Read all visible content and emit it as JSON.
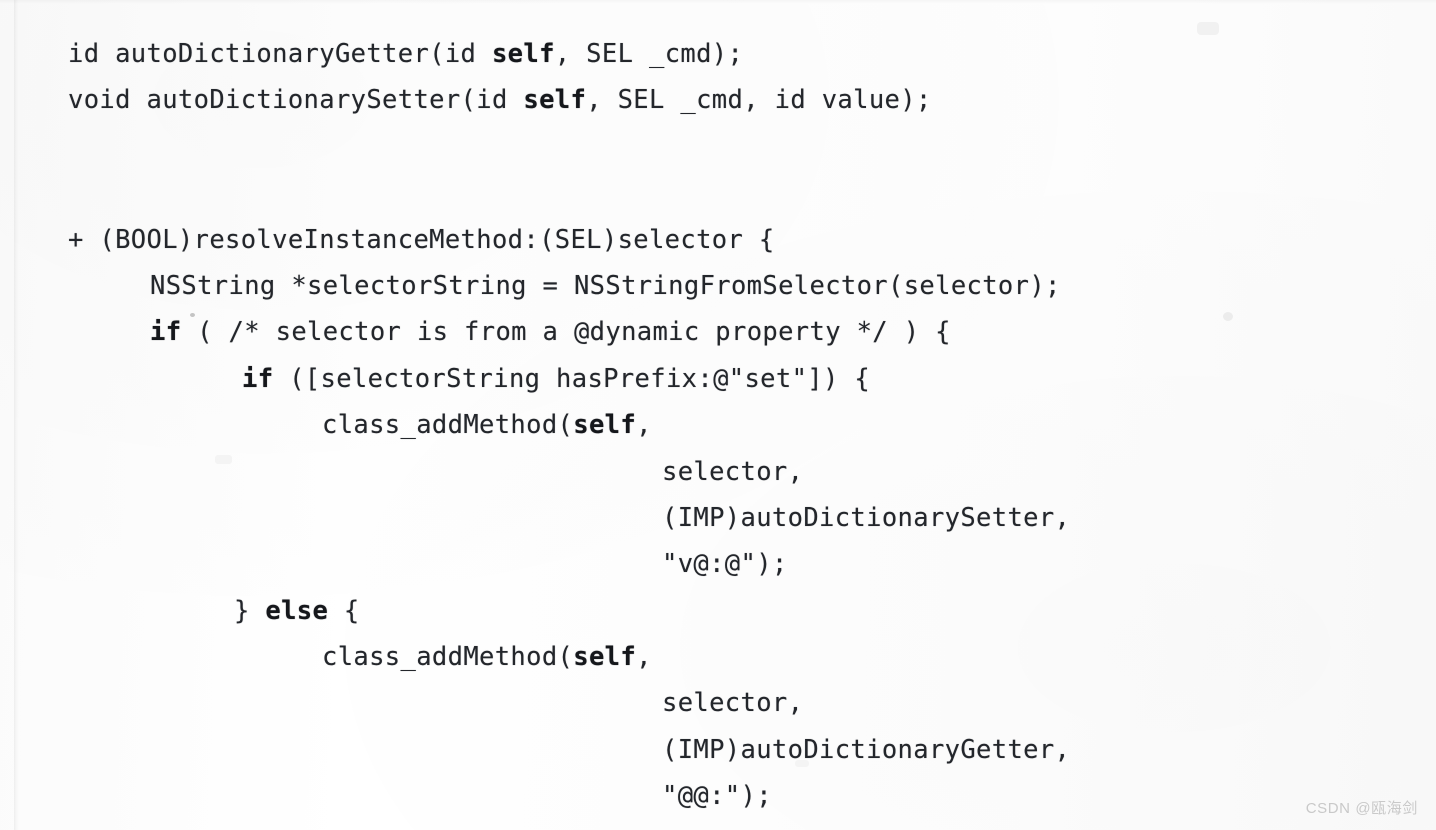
{
  "page": {
    "kind": "scanned-code-listing",
    "language": "Objective-C",
    "background_color": "#fdfdfd",
    "text_color": "#23262b"
  },
  "code": {
    "lines": [
      {
        "indent": 0,
        "segments": [
          {
            "text": "id autoDictionaryGetter(id ",
            "bold": false
          },
          {
            "text": "self",
            "bold": true
          },
          {
            "text": ", SEL _cmd);",
            "bold": false
          }
        ]
      },
      {
        "indent": 0,
        "segments": [
          {
            "text": "void autoDictionarySetter(id ",
            "bold": false
          },
          {
            "text": "self",
            "bold": true
          },
          {
            "text": ", SEL _cmd, id value);",
            "bold": false
          }
        ]
      },
      {
        "indent": 0,
        "segments": []
      },
      {
        "indent": 0,
        "segments": []
      },
      {
        "indent": 0,
        "segments": [
          {
            "text": "+ (BOOL)resolveInstanceMethod:(SEL)selector {",
            "bold": false
          }
        ]
      },
      {
        "indent": 1,
        "segments": [
          {
            "text": "NSString *selectorString = NSStringFromSelector(selector);",
            "bold": false
          }
        ]
      },
      {
        "indent": 1,
        "segments": [
          {
            "text": "if",
            "bold": true
          },
          {
            "text": " ( /* selector is from a @dynamic property */ ) {",
            "bold": false
          }
        ]
      },
      {
        "indent": 3,
        "segments": [
          {
            "text": "if",
            "bold": true
          },
          {
            "text": " ([selectorString hasPrefix:@\"set\"]) {",
            "bold": false
          }
        ]
      },
      {
        "indent": 4,
        "segments": [
          {
            "text": "class_addMethod(",
            "bold": false
          },
          {
            "text": "self",
            "bold": true
          },
          {
            "text": ",",
            "bold": false
          }
        ]
      },
      {
        "indent": 5,
        "segments": [
          {
            "text": "selector,",
            "bold": false
          }
        ]
      },
      {
        "indent": 5,
        "segments": [
          {
            "text": "(IMP)autoDictionarySetter,",
            "bold": false
          }
        ]
      },
      {
        "indent": 5,
        "segments": [
          {
            "text": "\"v@:@\");",
            "bold": false
          }
        ]
      },
      {
        "indent": 2,
        "segments": [
          {
            "text": "} ",
            "bold": false
          },
          {
            "text": "else",
            "bold": true
          },
          {
            "text": " {",
            "bold": false
          }
        ]
      },
      {
        "indent": 4,
        "segments": [
          {
            "text": "class_addMethod(",
            "bold": false
          },
          {
            "text": "self",
            "bold": true
          },
          {
            "text": ",",
            "bold": false
          }
        ]
      },
      {
        "indent": 5,
        "segments": [
          {
            "text": "selector,",
            "bold": false
          }
        ]
      },
      {
        "indent": 5,
        "segments": [
          {
            "text": "(IMP)autoDictionaryGetter,",
            "bold": false
          }
        ]
      },
      {
        "indent": 5,
        "segments": [
          {
            "text": "\"@@:\");",
            "bold": false
          }
        ]
      }
    ]
  },
  "watermark": {
    "text": "CSDN @瓯海剑"
  }
}
